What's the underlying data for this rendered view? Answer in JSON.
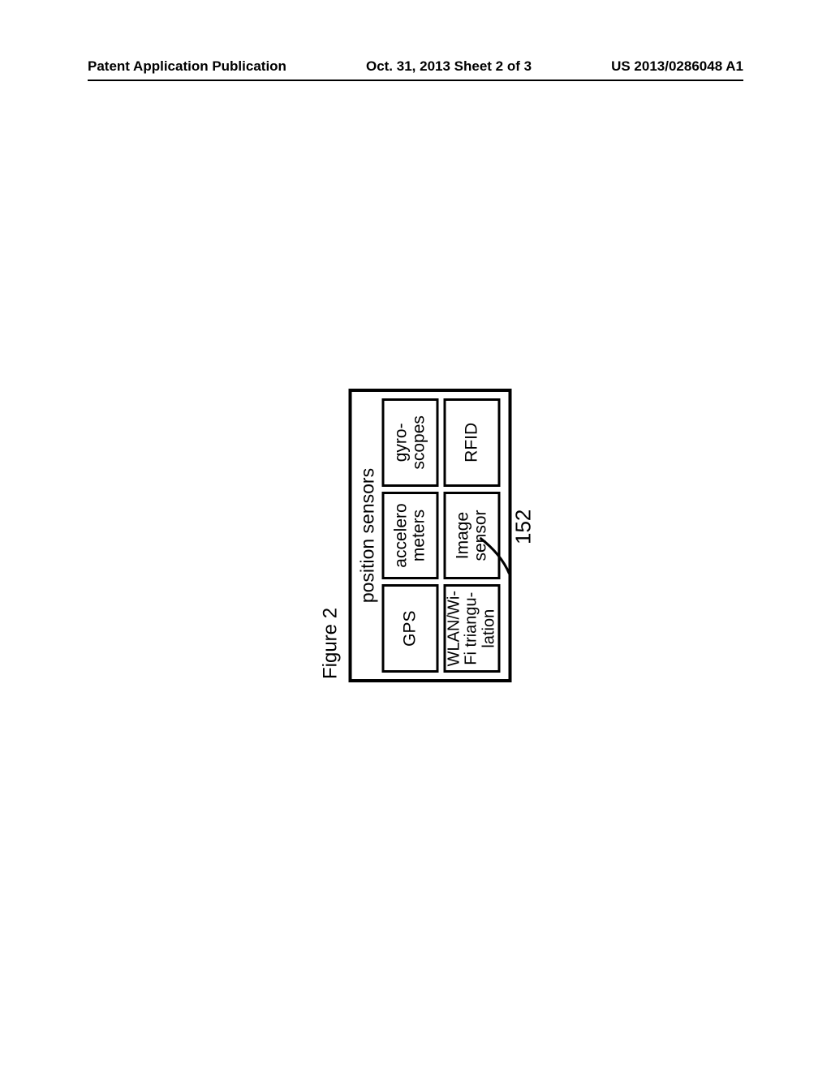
{
  "header": {
    "left": "Patent Application Publication",
    "center": "Oct. 31, 2013   Sheet 2 of 3",
    "right": "US 2013/0286048 A1"
  },
  "figure": {
    "label": "Figure 2",
    "title": "position sensors",
    "sensors": {
      "s0": "GPS",
      "s1_line1": "accelero",
      "s1_line2": "meters",
      "s2_line1": "gyro-",
      "s2_line2": "scopes",
      "s3_line1": "WLAN/Wi-",
      "s3_line2": "Fi triangu-",
      "s3_line3": "lation",
      "s4_line1": "Image",
      "s4_line2": "sensor",
      "s5": "RFID"
    },
    "ref_number": "152"
  }
}
